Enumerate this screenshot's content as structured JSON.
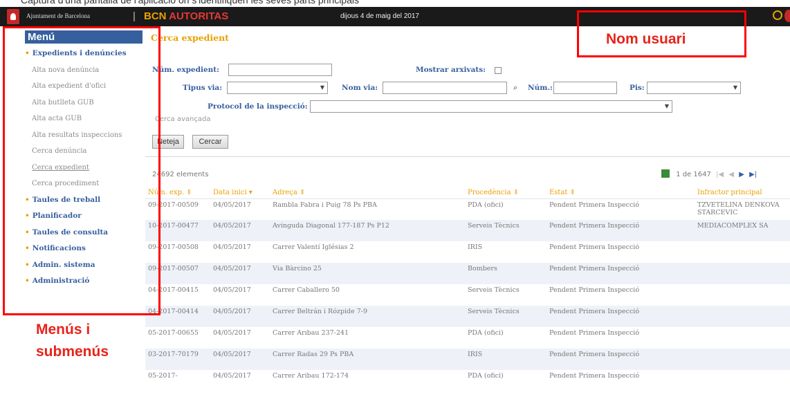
{
  "top_caption": "Captura d'una pantalla de l'aplicació on s'identifiquen les seves parts principals",
  "header": {
    "organization": "Ajuntament de Barcelona",
    "separator": "|",
    "app_name_prefix": "BCN",
    "app_name_suffix": "AUTORITAS",
    "date": "dijous 4 de maig del 2017",
    "icons": [
      "help-icon",
      "user-logo-icon"
    ]
  },
  "sidebar": {
    "title": "Menú",
    "items": [
      {
        "label": "Expedients i denúncies",
        "type": "main"
      },
      {
        "label": "Alta nova denúncia",
        "type": "sub"
      },
      {
        "label": "Alta expedient d'ofici",
        "type": "sub"
      },
      {
        "label": "Alta butlleta GUB",
        "type": "sub"
      },
      {
        "label": "Alta acta GUB",
        "type": "sub"
      },
      {
        "label": "Alta resultats inspeccions",
        "type": "sub"
      },
      {
        "label": "Cerca denúncia",
        "type": "sub"
      },
      {
        "label": "Cerca expedient",
        "type": "sub-active"
      },
      {
        "label": "Cerca procediment",
        "type": "sub"
      },
      {
        "label": "Taules de treball",
        "type": "main"
      },
      {
        "label": "Planificador",
        "type": "main"
      },
      {
        "label": "Taules de consulta",
        "type": "main"
      },
      {
        "label": "Notificacions",
        "type": "main"
      },
      {
        "label": "Admin. sistema",
        "type": "main"
      },
      {
        "label": "Administració",
        "type": "main"
      }
    ]
  },
  "search": {
    "title": "Cerca expedient",
    "num_label": "Núm. expedient:",
    "archived_label": "Mostrar arxivats:",
    "road_type_label": "Tipus via:",
    "road_name_label": "Nom via:",
    "number_label": "Núm.:",
    "floor_label": "Pis:",
    "protocol_label": "Protocol de la inspecció:",
    "advanced_link": "Cerca avançada",
    "clear_button": "Neteja",
    "search_button": "Cercar"
  },
  "results": {
    "count_text": "24692 elements",
    "pager_text": "1 de 1647",
    "columns": [
      "Núm. exp.",
      "Data inici",
      "Adreça",
      "Procedència",
      "Estat",
      "Infractor principal"
    ],
    "sort_marks": [
      "⇕",
      "▾",
      "⇕",
      "⇕",
      "⇕",
      ""
    ],
    "rows": [
      [
        "09-2017-00509",
        "04/05/2017",
        "Rambla Fabra i Puig 78 Ps PBA",
        "PDA (ofici)",
        "Pendent Primera Inspecció",
        "TZVETELINA DENKOVA STARCEVIC"
      ],
      [
        "10-2017-00477",
        "04/05/2017",
        "Avinguda Diagonal 177-187 Ps P12",
        "Serveis Tècnics",
        "Pendent Primera Inspecció",
        "MEDIACOMPLEX SA"
      ],
      [
        "09-2017-00508",
        "04/05/2017",
        "Carrer Valentí Iglésias 2",
        "IRIS",
        "Pendent Primera Inspecció",
        ""
      ],
      [
        "09-2017-00507",
        "04/05/2017",
        "Via Bàrcino 25",
        "Bombers",
        "Pendent Primera Inspecció",
        ""
      ],
      [
        "04-2017-00415",
        "04/05/2017",
        "Carrer Caballero 50",
        "Serveis Tècnics",
        "Pendent Primera Inspecció",
        ""
      ],
      [
        "04-2017-00414",
        "04/05/2017",
        "Carrer Beltrán i Rózpide 7-9",
        "Serveis Tècnics",
        "Pendent Primera Inspecció",
        ""
      ],
      [
        "05-2017-00655",
        "04/05/2017",
        "Carrer Arıbau 237-241",
        "PDA (ofici)",
        "Pendent Primera Inspecció",
        ""
      ],
      [
        "03-2017-70179",
        "04/05/2017",
        "Carrer Radas 29 Ps PBA",
        "IRIS",
        "Pendent Primera Inspecció",
        ""
      ],
      [
        "05-2017-",
        "04/05/2017",
        "Carrer Aribau 172-174",
        "PDA (ofici)",
        "Pendent Primera Inspecció",
        ""
      ]
    ]
  },
  "annotations": {
    "user_label": "Nom usuari",
    "menu_label_line1": "Menús i",
    "menu_label_line2": "submenús",
    "color": "#ff0000"
  }
}
